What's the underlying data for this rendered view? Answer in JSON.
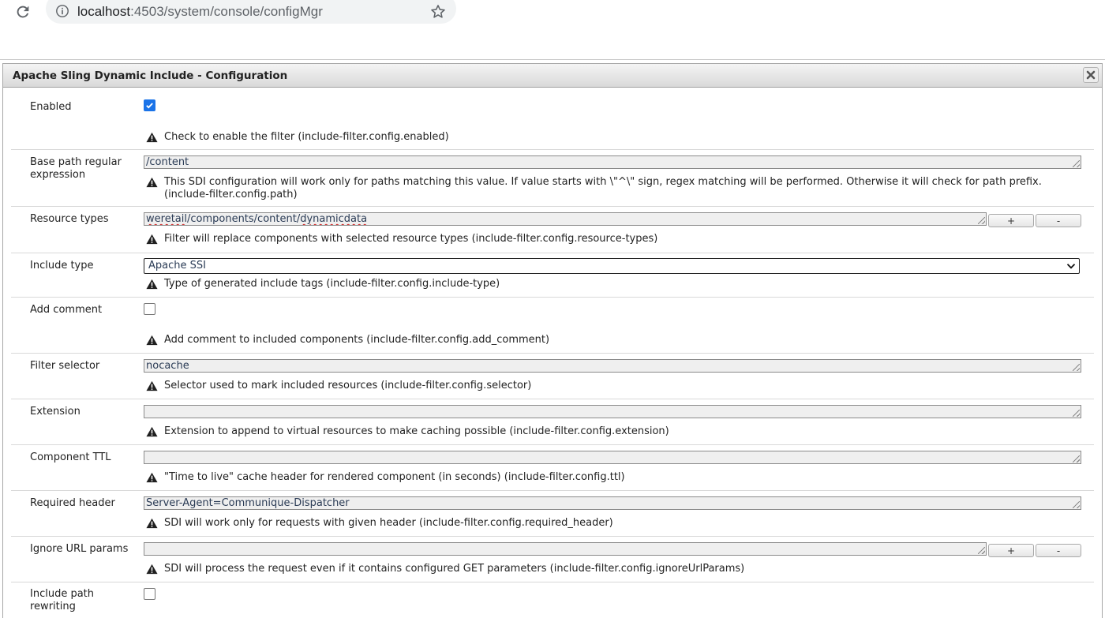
{
  "browser": {
    "url_host": "localhost",
    "url_rest": ":4503/system/console/configMgr"
  },
  "dialog": {
    "title": "Apache Sling Dynamic Include - Configuration"
  },
  "fields": {
    "enabled": {
      "label": "Enabled",
      "checked": true,
      "description": "Check to enable the filter (include-filter.config.enabled)"
    },
    "base_path": {
      "label": "Base path regular expression",
      "value": "/content",
      "description": "This SDI configuration will work only for paths matching this value. If value starts with \\\"^\\\" sign, regex matching will be performed. Otherwise it will check for path prefix. (include-filter.config.path)"
    },
    "resource_types": {
      "label": "Resource types",
      "value_parts": [
        "weretail",
        "/components/content/",
        "dynamicdata"
      ],
      "plus_label": "+",
      "minus_label": "-",
      "description": "Filter will replace components with selected resource types (include-filter.config.resource-types)"
    },
    "include_type": {
      "label": "Include type",
      "selected": "Apache SSI",
      "description": "Type of generated include tags (include-filter.config.include-type)"
    },
    "add_comment": {
      "label": "Add comment",
      "checked": false,
      "description": "Add comment to included components (include-filter.config.add_comment)"
    },
    "filter_selector": {
      "label": "Filter selector",
      "value": "nocache",
      "description": "Selector used to mark included resources (include-filter.config.selector)"
    },
    "extension": {
      "label": "Extension",
      "value": "",
      "description": "Extension to append to virtual resources to make caching possible (include-filter.config.extension)"
    },
    "component_ttl": {
      "label": "Component TTL",
      "value": "",
      "description": "\"Time to live\" cache header for rendered component (in seconds) (include-filter.config.ttl)"
    },
    "required_header": {
      "label": "Required header",
      "value": "Server-Agent=Communique-Dispatcher",
      "description": "SDI will work only for requests with given header (include-filter.config.required_header)"
    },
    "ignore_url_params": {
      "label": "Ignore URL params",
      "value": "",
      "plus_label": "+",
      "minus_label": "-",
      "description": "SDI will process the request even if it contains configured GET parameters (include-filter.config.ignoreUrlParams)"
    },
    "include_path_rewriting": {
      "label": "Include path rewriting",
      "checked": false
    }
  },
  "icons": {
    "reload": "reload-icon",
    "info": "info-icon",
    "star": "star-icon",
    "close": "close-icon",
    "warning": "warning-icon",
    "checkmark": "checkmark-icon",
    "chevron": "chevron-down-icon"
  },
  "colors": {
    "checkbox_accent": "#1a73e8",
    "input_background": "#efefef",
    "titlebar_gradient_top": "#f4f4f4",
    "titlebar_gradient_bottom": "#d9d9d9"
  }
}
